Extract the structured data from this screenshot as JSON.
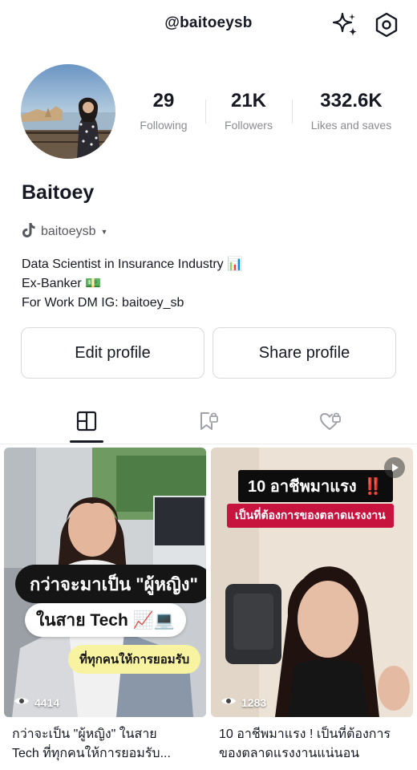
{
  "header": {
    "username": "@baitoeysb"
  },
  "profile": {
    "display_name": "Baitoey",
    "handle": "baitoeysb",
    "stats": [
      {
        "value": "29",
        "label": "Following"
      },
      {
        "value": "21K",
        "label": "Followers"
      },
      {
        "value": "332.6K",
        "label": "Likes and saves"
      }
    ],
    "bio": [
      "Data Scientist in Insurance Industry 📊",
      "Ex-Banker 💵",
      "For Work DM IG: baitoey_sb"
    ]
  },
  "buttons": {
    "edit": "Edit profile",
    "share": "Share profile"
  },
  "videos": [
    {
      "views": "4414",
      "overlay": {
        "line1": "กว่าจะมาเป็น \"ผู้หญิง\"",
        "line2": "ในสาย Tech 📈💻",
        "line3": "ที่ทุกคนให้การยอมรับ"
      },
      "title_lines": [
        "กว่าจะเป็น \"ผู้หญิง\" ในสาย",
        "Tech ที่ทุกคนให้การยอมรับ..."
      ]
    },
    {
      "views": "1283",
      "overlay": {
        "headline": "10 อาชีพมาแรง",
        "headline_emoji": "‼️",
        "subline": "เป็นที่ต้องการของตลาดแรงงาน"
      },
      "title_lines": [
        "10 อาชีพมาแรง ! เป็นที่ต้องการ",
        "ของตลาดแรงงานแน่นอน"
      ]
    }
  ],
  "colors": {
    "text": "#161823",
    "muted": "#8a8b91",
    "accent_red": "#c7143f",
    "yellow": "#f8f3a0"
  }
}
